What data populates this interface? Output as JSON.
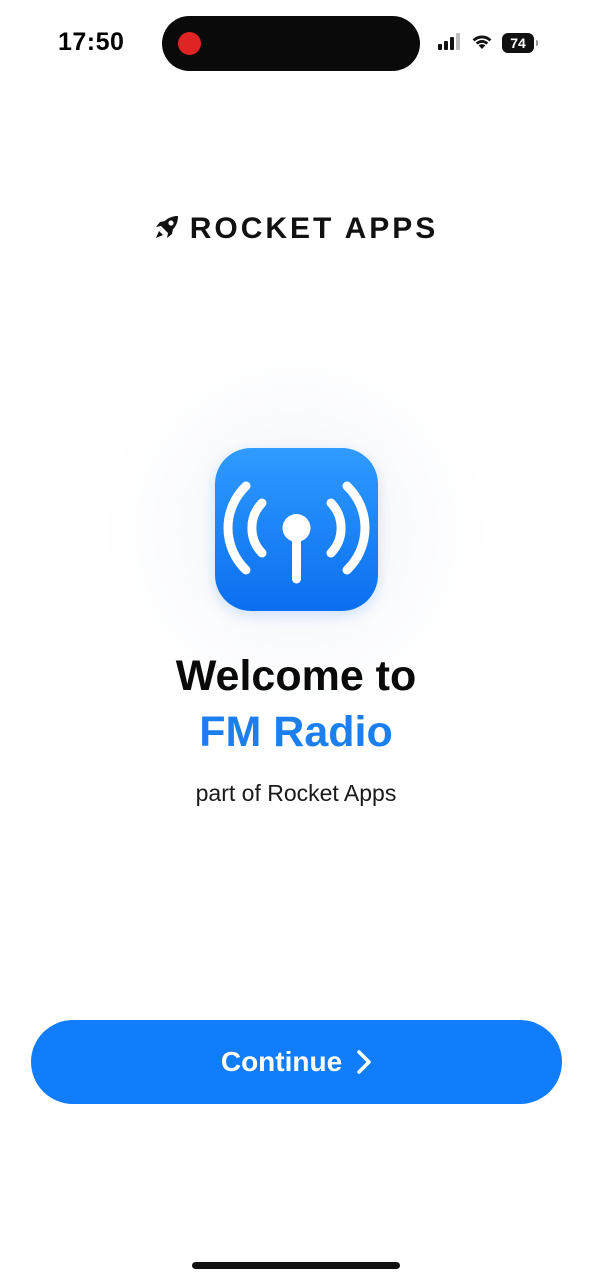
{
  "status_bar": {
    "time": "17:50",
    "battery": "74",
    "icons": [
      "signal-icon",
      "wifi-icon",
      "battery-icon"
    ],
    "recording_color": "#e02424"
  },
  "brand": {
    "name": "ROCKET APPS",
    "logo_icon": "rocket-icon"
  },
  "app": {
    "icon": "radio-antenna-icon",
    "icon_color": "#1a86f7"
  },
  "welcome": {
    "line1": "Welcome to",
    "app_name": "FM Radio",
    "subtitle": "part of Rocket Apps",
    "accent_color": "#1c7ff0"
  },
  "actions": {
    "continue_label": "Continue",
    "continue_icon": "chevron-right-icon",
    "button_color": "#117dfa"
  }
}
